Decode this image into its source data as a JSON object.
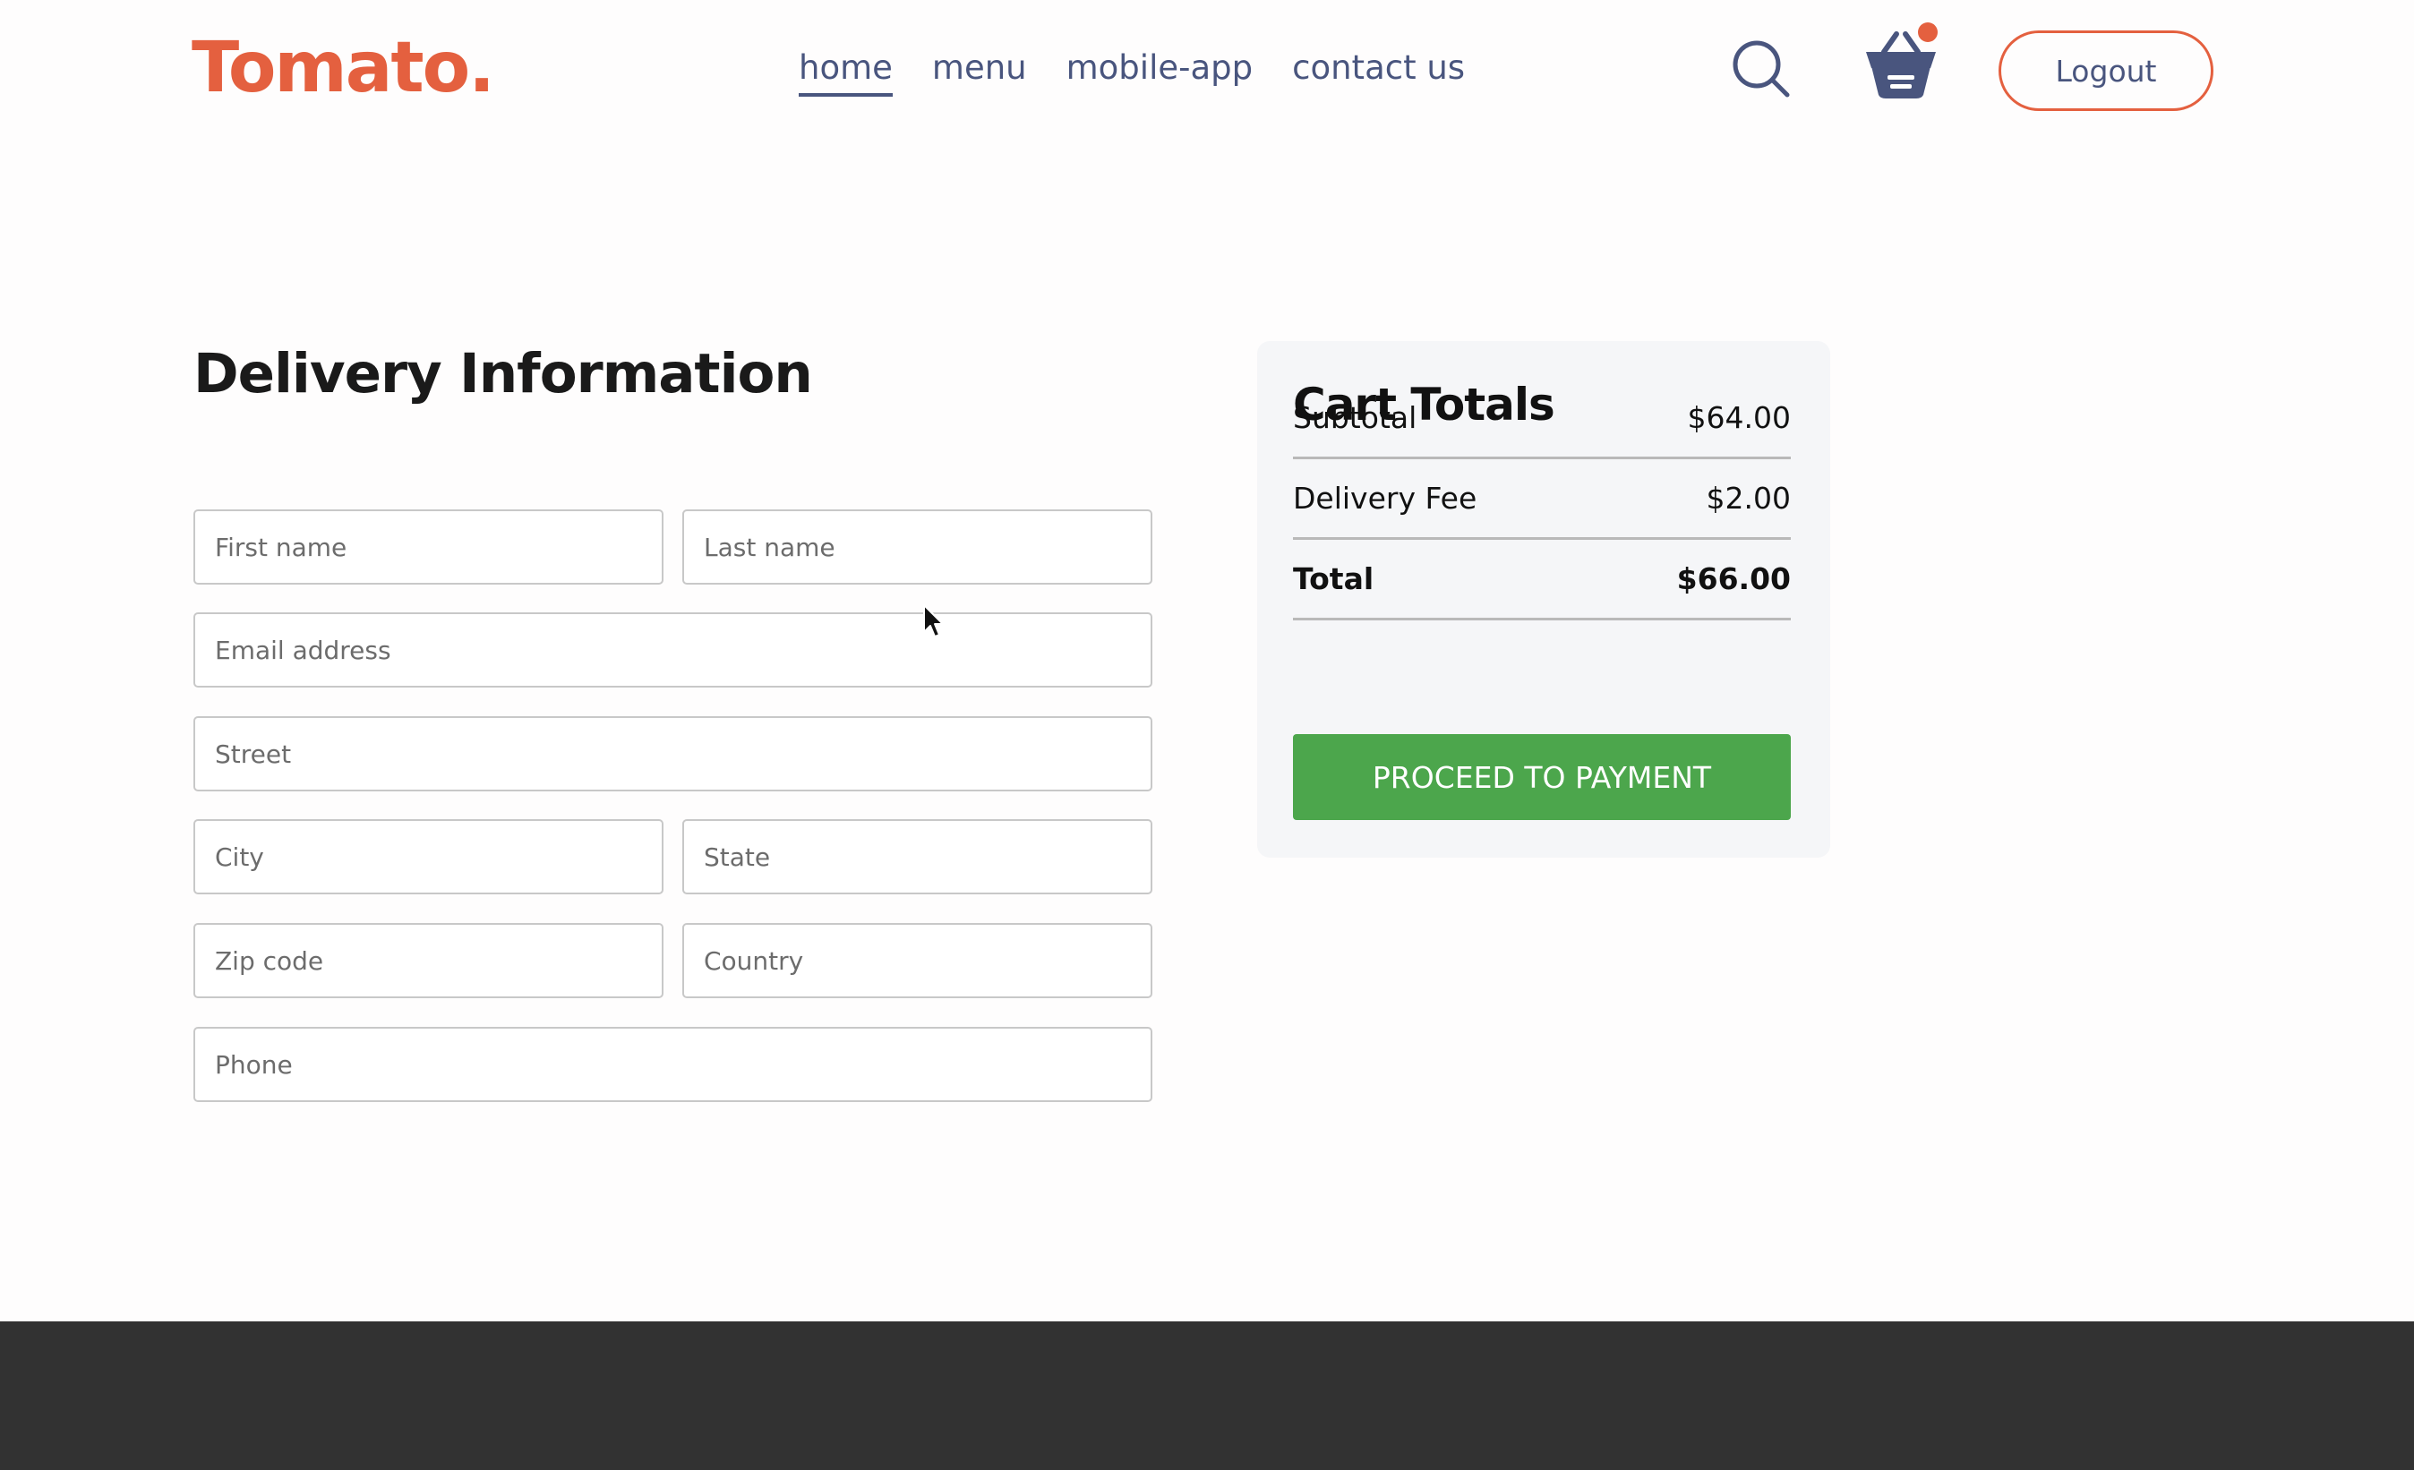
{
  "header": {
    "logo": "Tomato.",
    "nav_items": [
      {
        "label": "home",
        "active": true
      },
      {
        "label": "menu",
        "active": false
      },
      {
        "label": "mobile-app",
        "active": false
      },
      {
        "label": "contact us",
        "active": false
      }
    ],
    "search_icon": "search-icon",
    "basket_icon": "basket-icon",
    "cart_has_items": true,
    "logout_label": "Logout"
  },
  "delivery": {
    "title": "Delivery Information",
    "fields": {
      "first_name": {
        "placeholder": "First name",
        "value": ""
      },
      "last_name": {
        "placeholder": "Last name",
        "value": ""
      },
      "email": {
        "placeholder": "Email address",
        "value": ""
      },
      "street": {
        "placeholder": "Street",
        "value": ""
      },
      "city": {
        "placeholder": "City",
        "value": ""
      },
      "state": {
        "placeholder": "State",
        "value": ""
      },
      "zip": {
        "placeholder": "Zip code",
        "value": ""
      },
      "country": {
        "placeholder": "Country",
        "value": ""
      },
      "phone": {
        "placeholder": "Phone",
        "value": ""
      }
    }
  },
  "cart_totals": {
    "title": "Cart Totals",
    "rows": [
      {
        "label": "Subtotal",
        "value": "$64.00"
      },
      {
        "label": "Delivery Fee",
        "value": "$2.00"
      },
      {
        "label": "Total",
        "value": "$66.00"
      }
    ],
    "pay_button": "PROCEED TO PAYMENT"
  },
  "colors": {
    "brand": "#e4603f",
    "nav_text": "#49557e",
    "pay_button": "#4ca64c",
    "footer": "#323232"
  }
}
